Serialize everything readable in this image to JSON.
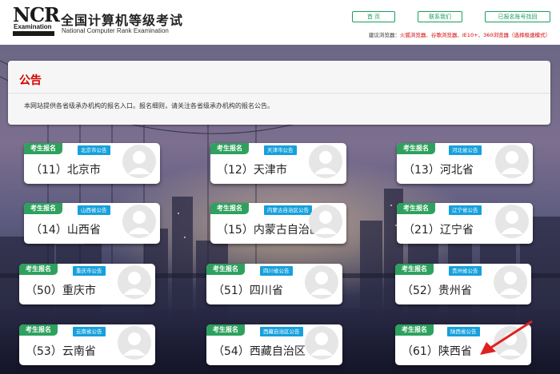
{
  "header": {
    "logo_letters": "NCR",
    "logo_word": "Examination",
    "title": "全国计算机等级考试",
    "subtitle": "National Computer Rank Examination",
    "nav": [
      {
        "label": "首 页"
      },
      {
        "label": "联系我们"
      },
      {
        "label": "已报名账号找回"
      }
    ],
    "browser_tip_prefix": "建议浏览器：",
    "browser_tip_list": "火狐浏览器、谷歌浏览器、IE10+、360浏览器（选择极速模式）"
  },
  "notice": {
    "title": "公告",
    "text": "本网站提供各省级承办机构的报名入口。报名细则，请关注各省级承办机构的报名公告。"
  },
  "card_tag": "考生报名",
  "provinces": [
    {
      "name": "（11）北京市",
      "pub": "北京市公告"
    },
    {
      "name": "（12）天津市",
      "pub": "天津市公告"
    },
    {
      "name": "（13）河北省",
      "pub": "河北省公告"
    },
    {
      "name": "（14）山西省",
      "pub": "山西省公告"
    },
    {
      "name": "（15）内蒙古自治区",
      "pub": "内蒙古自治区公告"
    },
    {
      "name": "（21）辽宁省",
      "pub": "辽宁省公告"
    },
    {
      "name": "（50）重庆市",
      "pub": "重庆市公告"
    },
    {
      "name": "（51）四川省",
      "pub": "四川省公告"
    },
    {
      "name": "（52）贵州省",
      "pub": "贵州省公告"
    },
    {
      "name": "（53）云南省",
      "pub": "云南省公告"
    },
    {
      "name": "（54）西藏自治区",
      "pub": "西藏自治区公告"
    },
    {
      "name": "（61）陕西省",
      "pub": "陕西省公告"
    }
  ],
  "colors": {
    "accent_green": "#2ea15e",
    "badge_blue": "#16a0dc",
    "notice_red": "#d40000",
    "arrow_red": "#e02020"
  },
  "icons": {
    "avatar": "user-avatar-icon",
    "annotation": "red-arrow-icon"
  }
}
